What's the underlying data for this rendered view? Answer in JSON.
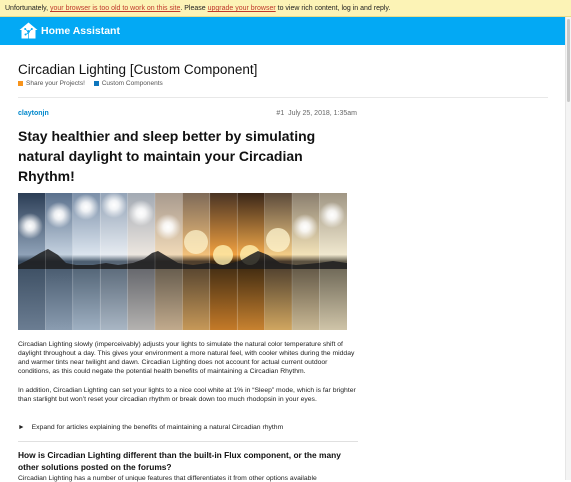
{
  "notice": {
    "prefix": "Unfortunately, ",
    "link1": "your browser is too old to work on this site",
    "middle": ". Please ",
    "link2": "upgrade your browser",
    "suffix": " to view rich content, log in and reply."
  },
  "header": {
    "logo_text": "Home Assistant",
    "accent": "#03a9f4"
  },
  "topic": {
    "title": "Circadian Lighting [Custom Component]",
    "categories": [
      {
        "label": "Share your Projects!",
        "color": "#f7941d"
      },
      {
        "label": "Custom Components",
        "color": "#0e76bd"
      }
    ]
  },
  "post": {
    "author": "claytonjn",
    "number": "#1",
    "date": "July 25, 2018, 1:35am",
    "heading": "Stay healthier and sleep better by simulating natural daylight to maintain your Circadian Rhythm!",
    "paragraphs": [
      "Circadian Lighting slowly (imperceivably) adjusts your lights to simulate the natural color temperature shift of daylight throughout a day. This gives your environment a more natural feel, with cooler whites during the midday and warmer tints near twilight and dawn. Circadian Lighting does not account for actual current outdoor conditions, as this could negate the potential health benefits of maintaining a Circadian Rhythm.",
      "In addition, Circadian Lighting can set your lights to a nice cool white at 1% in “Sleep” mode, which is far brighter than starlight but won’t reset your circadian rhythm or break down too much rhodopsin in your eyes."
    ],
    "expand_label": "Expand for articles explaining the benefits of maintaining a natural Circadian rhythm",
    "subheading": "How is Circadian Lighting different than the built-in Flux component, or the many other solutions posted on the forums?",
    "cut_text": "Circadian Lighting has a number of unique features that differentiates it from other options available"
  }
}
